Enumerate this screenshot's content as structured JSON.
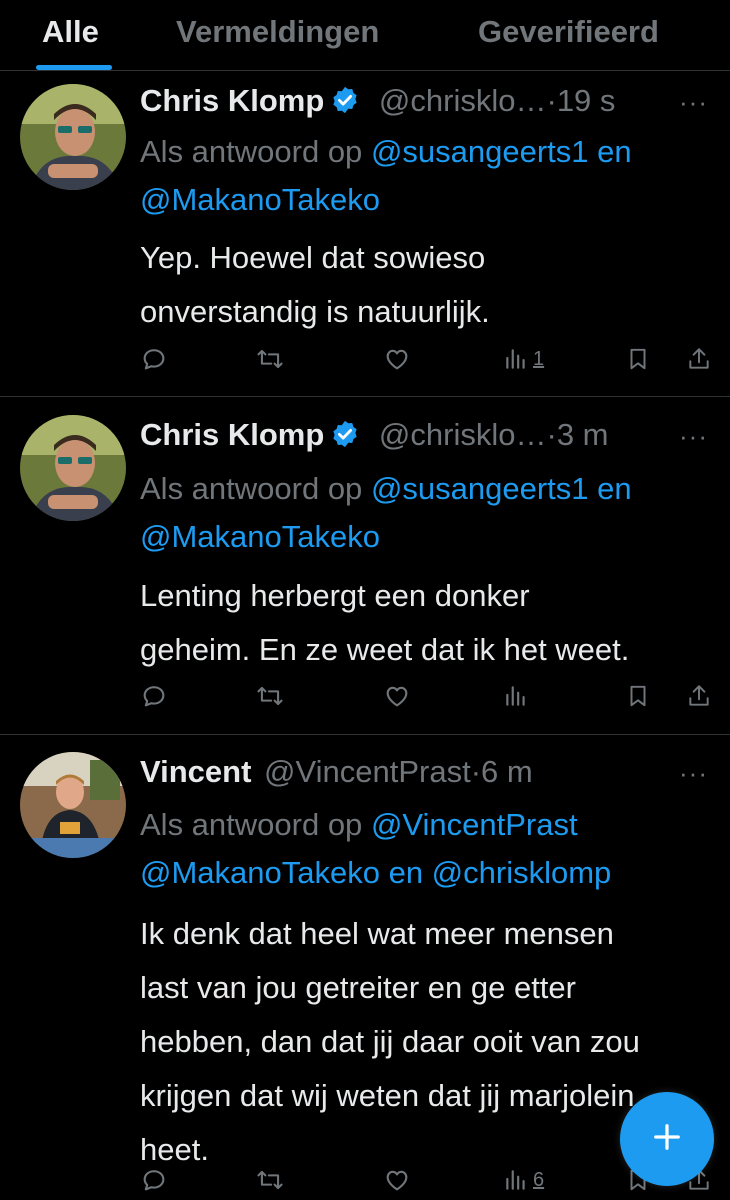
{
  "tabs": [
    {
      "label": "Alle",
      "active": true
    },
    {
      "label": "Vermeldingen",
      "active": false
    },
    {
      "label": "Geverifieerd",
      "active": false
    }
  ],
  "colors": {
    "accent": "#1d9bf0",
    "muted": "#71767b",
    "text": "#e7e9ea",
    "background": "#000000"
  },
  "tweets": [
    {
      "name": "Chris Klomp",
      "verified": true,
      "handle": "@chrisklo…",
      "separator": "·",
      "time": "19 s",
      "reply_prefix": "Als antwoord op",
      "reply_link_1": "@susangeerts1 en",
      "reply_link_2": "@MakanoTakeko",
      "text_line_1": "Yep. Hoewel dat sowieso",
      "text_line_2": "onverstandig is natuurlijk.",
      "views": "1"
    },
    {
      "name": "Chris Klomp",
      "verified": true,
      "handle": "@chrisklo…",
      "separator": "·",
      "time": "3 m",
      "reply_prefix": "Als antwoord op",
      "reply_link_1": "@susangeerts1 en",
      "reply_link_2": "@MakanoTakeko",
      "text_line_1": "Lenting herbergt een donker",
      "text_line_2": "geheim. En ze weet dat ik het weet.",
      "views": ""
    },
    {
      "name": "Vincent",
      "verified": false,
      "handle": "@VincentPrast",
      "separator": "·",
      "time": "6 m",
      "reply_prefix": "Als antwoord op",
      "reply_link_1": "@VincentPrast",
      "reply_link_2": "@MakanoTakeko en @chrisklomp",
      "text_line_1": "Ik denk dat heel wat meer mensen",
      "text_line_2": "last van jou getreiter en ge etter",
      "text_line_3": "hebben, dan dat jij daar ooit van zou",
      "text_line_4": "krijgen dat wij weten dat jij marjolein",
      "text_line_5": "heet.",
      "views": "6"
    }
  ],
  "icons": {
    "reply": "reply-icon",
    "retweet": "retweet-icon",
    "like": "heart-icon",
    "views": "views-chart-icon",
    "bookmark": "bookmark-icon",
    "share": "share-icon",
    "more": "more-icon",
    "compose": "plus-icon"
  },
  "more_glyph": "···",
  "fab_glyph": "+"
}
